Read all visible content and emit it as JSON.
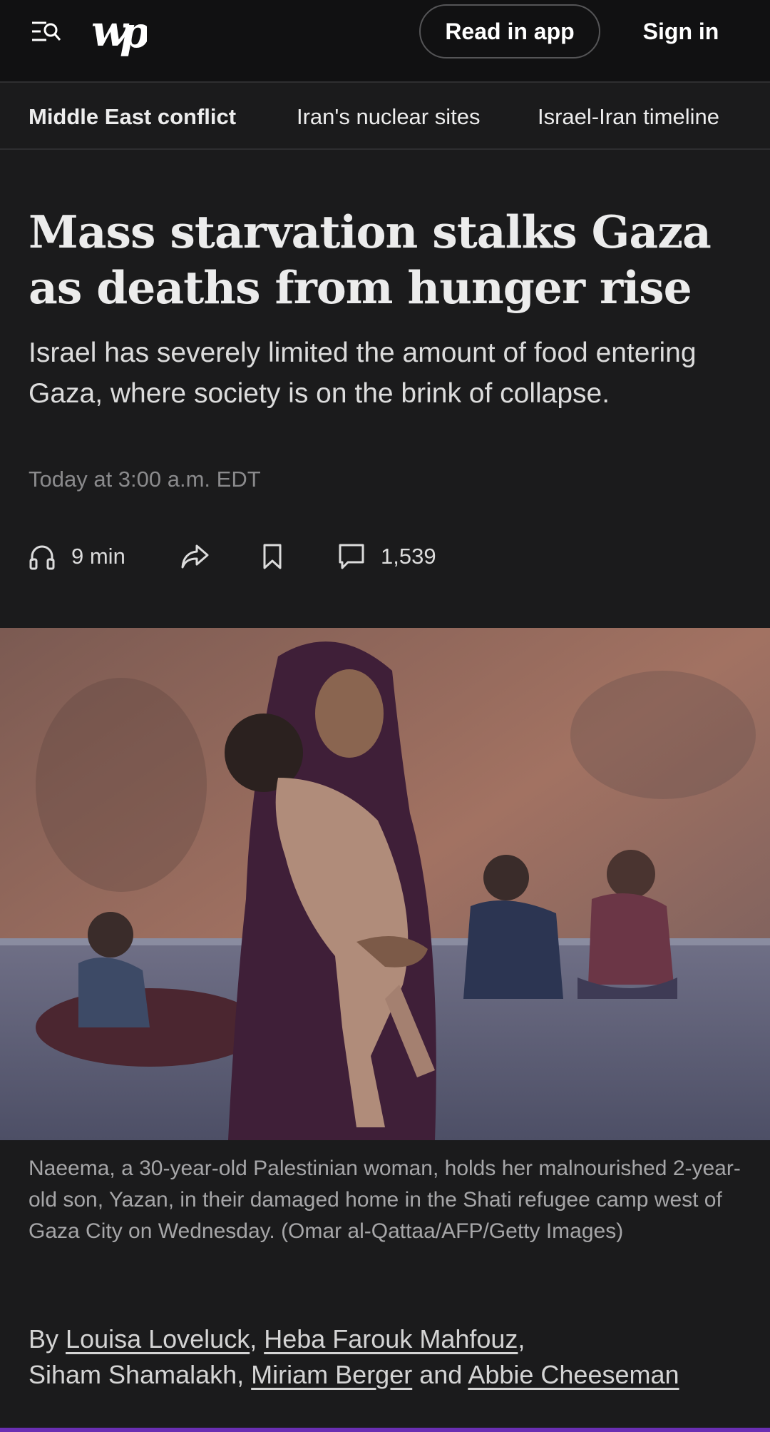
{
  "header": {
    "read_in_app": "Read in app",
    "sign_in": "Sign in"
  },
  "nav": {
    "items": [
      {
        "label": "Middle East conflict"
      },
      {
        "label": "Iran's nuclear sites"
      },
      {
        "label": "Israel-Iran timeline"
      }
    ]
  },
  "article": {
    "headline": "Mass starvation stalks Gaza as deaths from hunger rise",
    "dek": "Israel has severely limited the amount of food entering Gaza, where society is on the brink of collapse.",
    "dateline": "Today at 3:00 a.m. EDT",
    "listen_time": "9 min",
    "comment_count": "1,539",
    "caption": "Naeema, a 30-year-old Palestinian woman, holds her malnourished 2-year-old son, Yazan, in their damaged home in the Shati refugee camp west of Gaza City on Wednesday. (Omar al-Qattaa/AFP/Getty Images)",
    "byline": {
      "prefix": "By",
      "authors": [
        "Louisa Loveluck",
        "Heba Farouk Mahfouz",
        "Siham Shamalakh",
        "Miriam Berger",
        "Abbie Cheeseman"
      ],
      "joiner_and": "and"
    }
  },
  "colors": {
    "background": "#1b1b1c",
    "topbar": "#111112",
    "accent": "#6a2fb3"
  },
  "icons": {
    "menu": "menu-search-icon",
    "listen": "headphones-icon",
    "share": "share-icon",
    "save": "bookmark-icon",
    "comments": "comment-icon"
  }
}
